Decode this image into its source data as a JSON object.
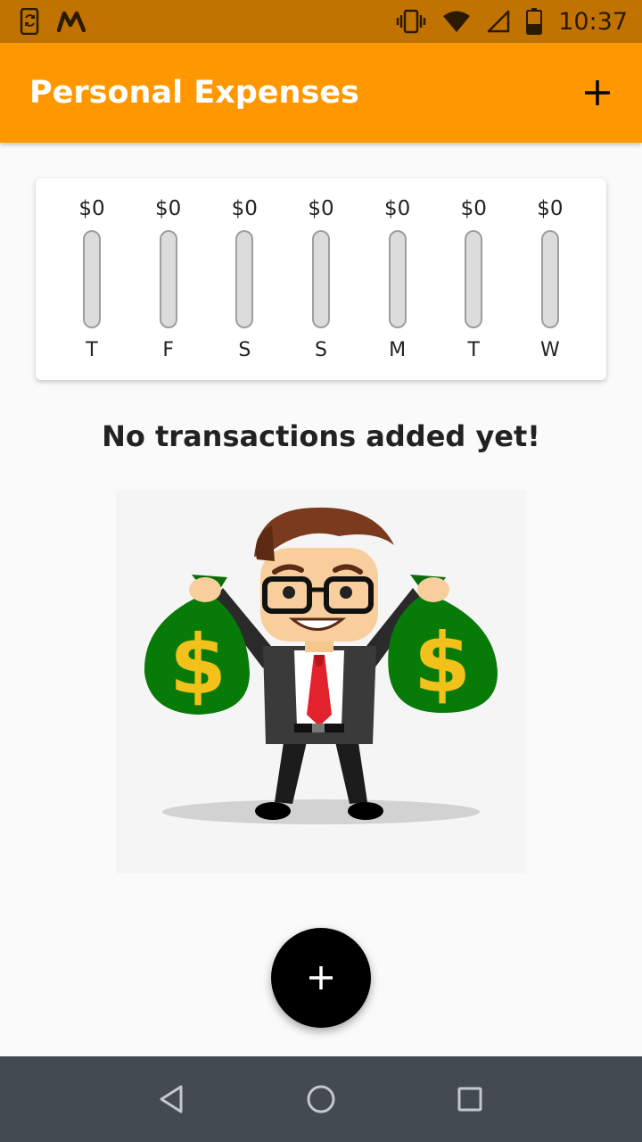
{
  "status_bar": {
    "time": "10:37",
    "icons": [
      "phone-sync-icon",
      "m-logo-icon",
      "vibrate-icon",
      "wifi-icon",
      "signal-icon",
      "battery-icon"
    ]
  },
  "app_bar": {
    "title": "Personal Expenses",
    "action_icon": "plus-icon",
    "background": "#ff9800"
  },
  "chart": {
    "bars": [
      {
        "day": "T",
        "amount": "$0",
        "fraction": 0
      },
      {
        "day": "F",
        "amount": "$0",
        "fraction": 0
      },
      {
        "day": "S",
        "amount": "$0",
        "fraction": 0
      },
      {
        "day": "S",
        "amount": "$0",
        "fraction": 0
      },
      {
        "day": "M",
        "amount": "$0",
        "fraction": 0
      },
      {
        "day": "T",
        "amount": "$0",
        "fraction": 0
      },
      {
        "day": "W",
        "amount": "$0",
        "fraction": 0
      }
    ]
  },
  "empty_state": {
    "message": "No transactions added yet!",
    "illustration": "businessman-with-money-bags"
  },
  "fab": {
    "icon": "plus-icon",
    "color": "#000000"
  },
  "nav_bar": {
    "buttons": [
      "back-icon",
      "home-icon",
      "recents-icon"
    ]
  }
}
